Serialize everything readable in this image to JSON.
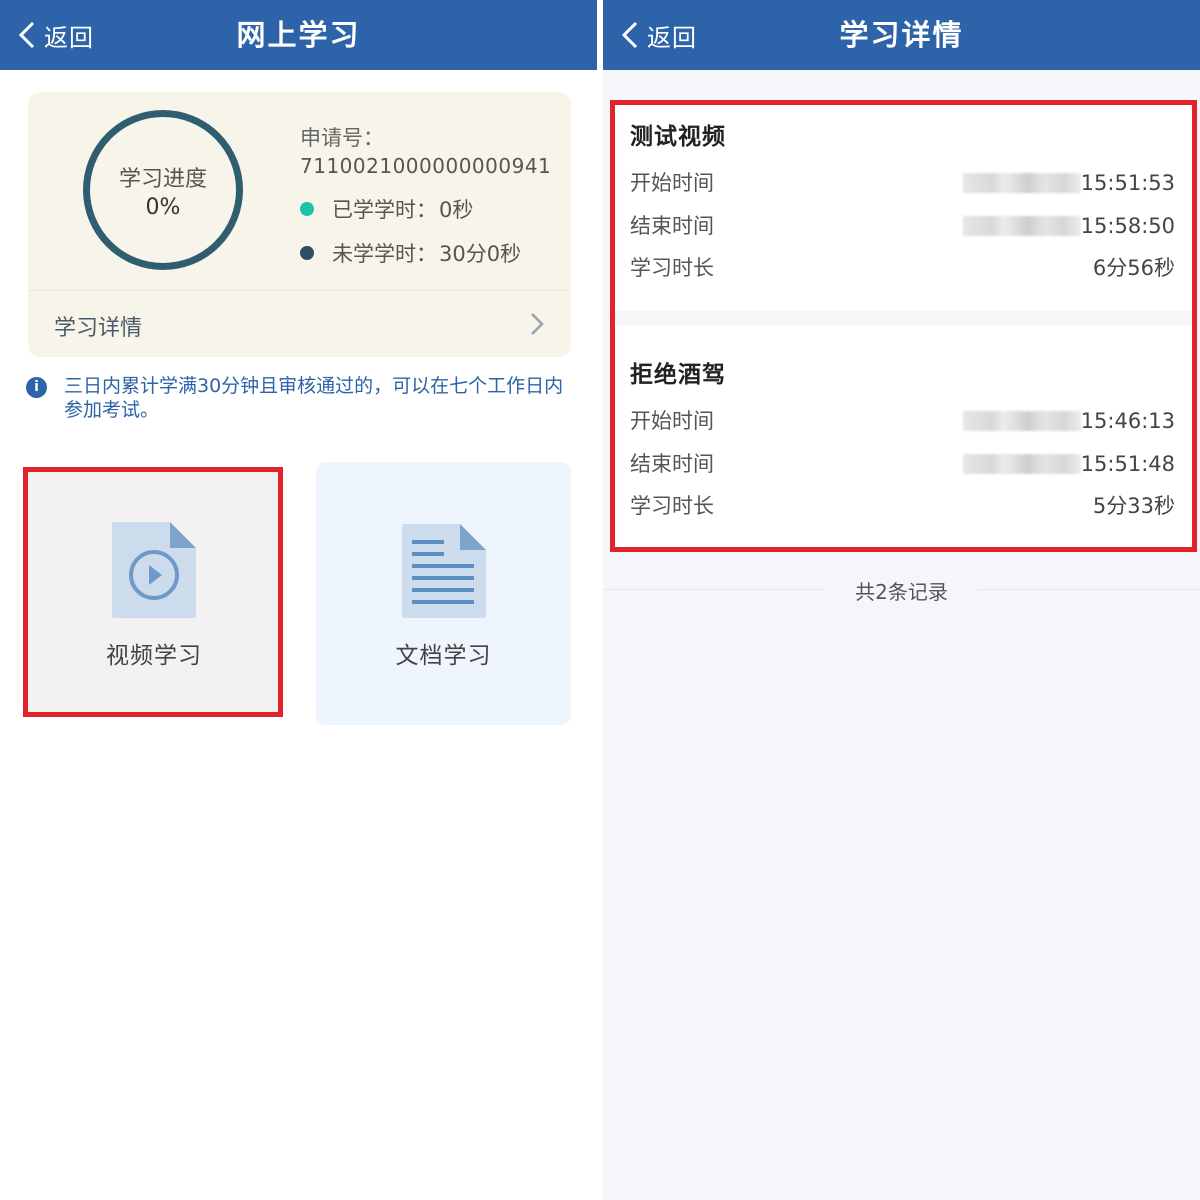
{
  "left": {
    "nav": {
      "back_label": "返回",
      "title": "网上学习"
    },
    "progress": {
      "label": "学习进度",
      "value": "0%",
      "percent": 0
    },
    "application": {
      "label": "申请号：",
      "number": "7110021000000000941"
    },
    "studied": {
      "label": "已学学时：",
      "value": "0秒",
      "color": "#1cc3a7"
    },
    "remaining": {
      "label": "未学学时：",
      "value": "30分0秒",
      "color": "#2e4c63"
    },
    "detail_link": "学习详情",
    "notice": "三日内累计学满30分钟且审核通过的，可以在七个工作日内参加考试。",
    "tiles": [
      {
        "label": "视频学习",
        "icon": "video-file-icon"
      },
      {
        "label": "文档学习",
        "icon": "document-file-icon"
      }
    ]
  },
  "right": {
    "nav": {
      "back_label": "返回",
      "title": "学习详情"
    },
    "records": [
      {
        "title": "测试视频",
        "rows": [
          {
            "key": "开始时间",
            "value": "15:51:53"
          },
          {
            "key": "结束时间",
            "value": "15:58:50"
          },
          {
            "key": "学习时长",
            "value": "6分56秒"
          }
        ]
      },
      {
        "title": "拒绝酒驾",
        "rows": [
          {
            "key": "开始时间",
            "value": "15:46:13"
          },
          {
            "key": "结束时间",
            "value": "15:51:48"
          },
          {
            "key": "学习时长",
            "value": "5分33秒"
          }
        ]
      }
    ],
    "footer": "共2条记录"
  },
  "colors": {
    "nav": "#2d63a8",
    "highlight": "#e3232b",
    "ring": "#2e5e6f"
  }
}
